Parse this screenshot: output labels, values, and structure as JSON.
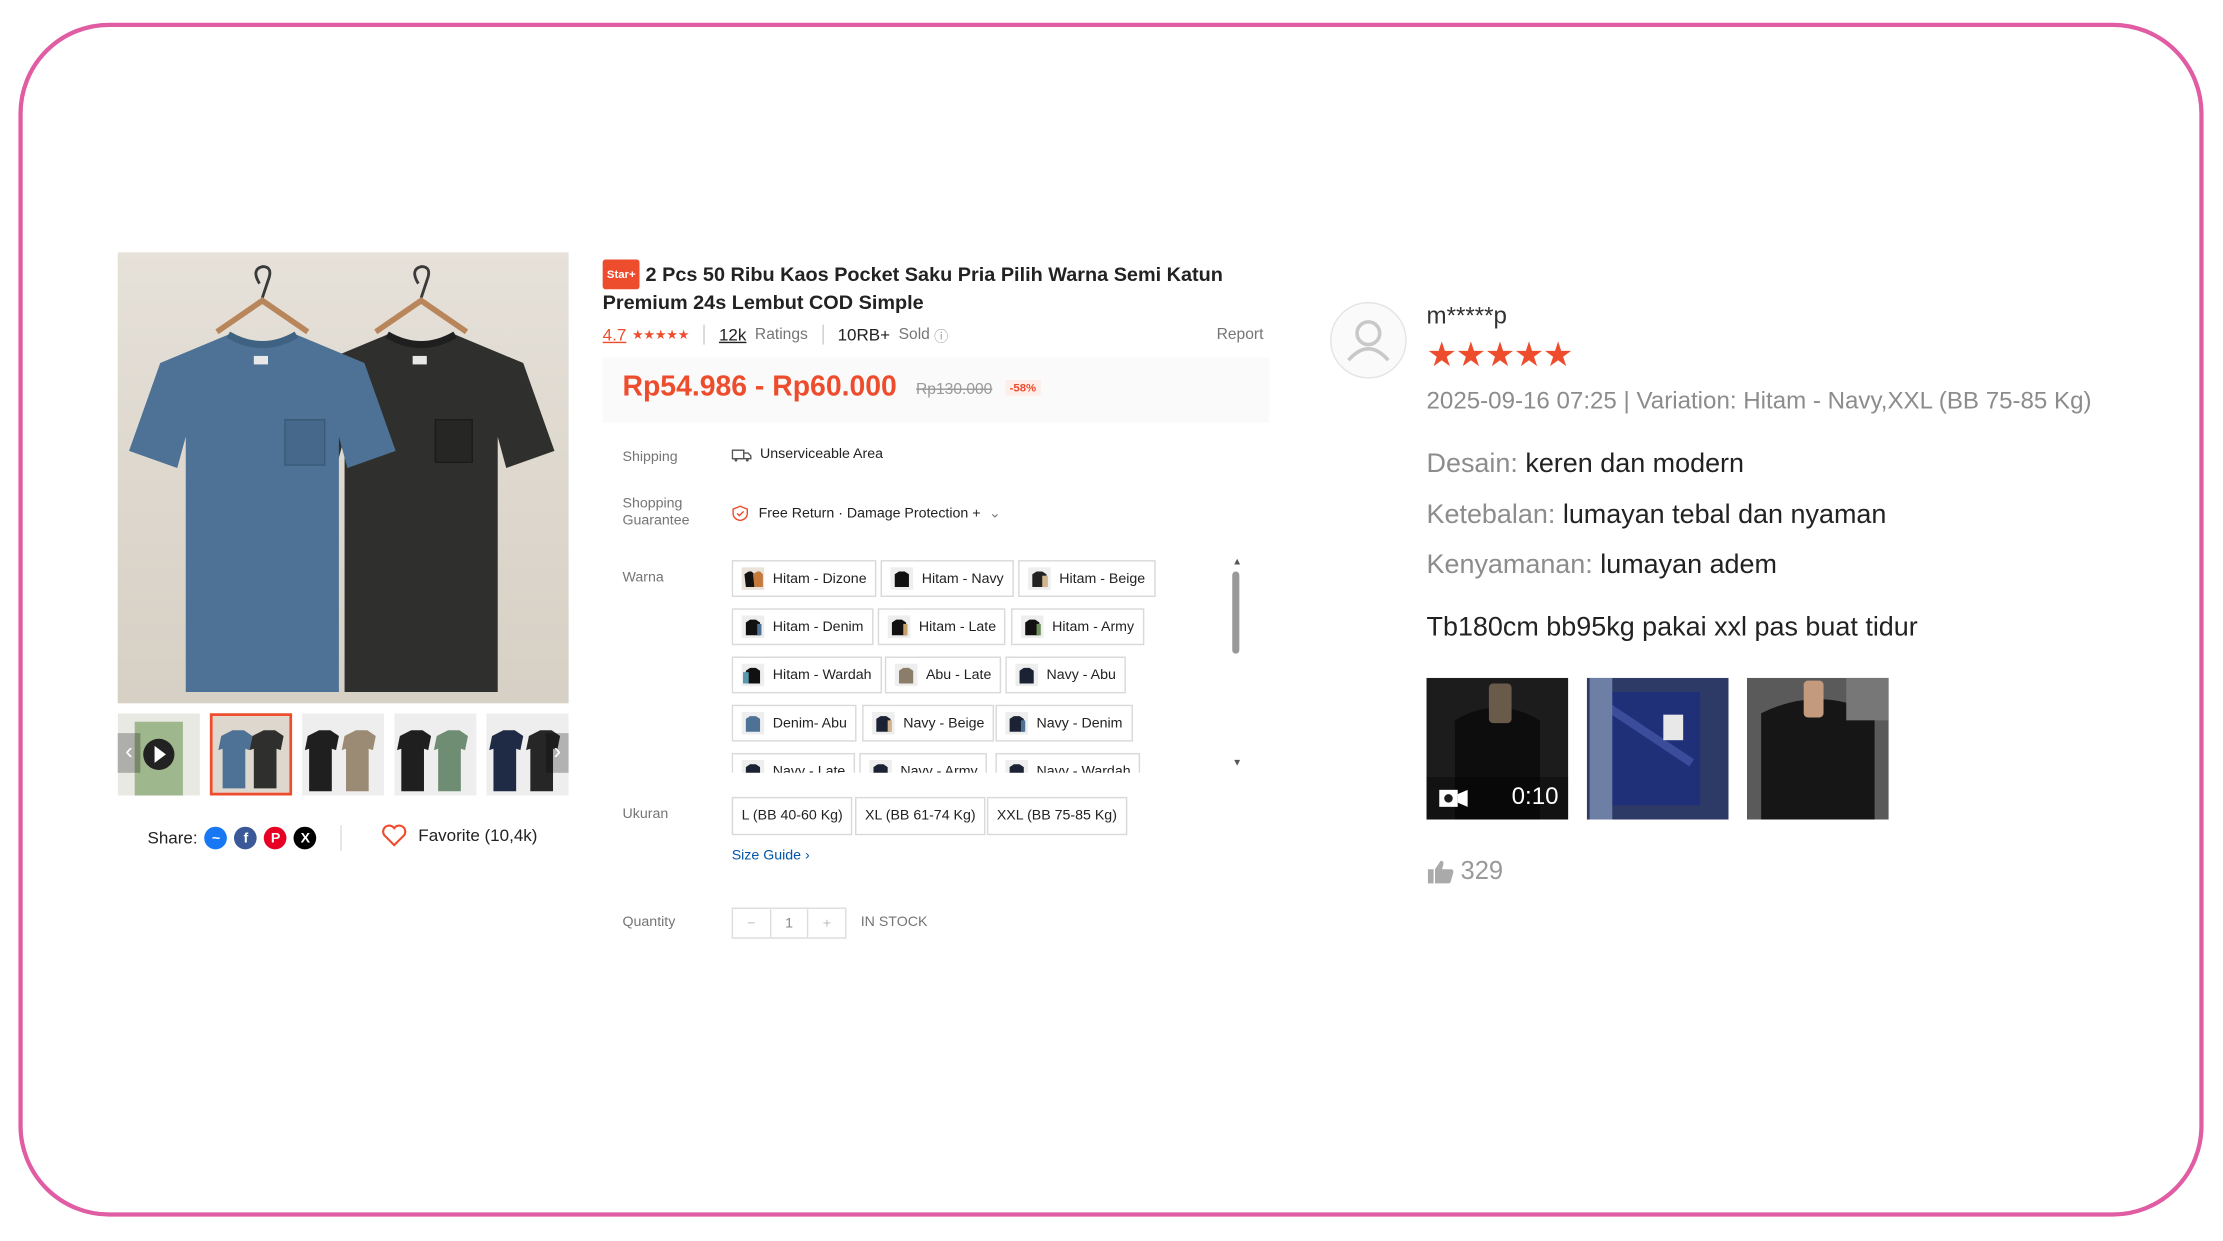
{
  "product": {
    "badge": "Star+",
    "title": "2 Pcs 50 Ribu Kaos Pocket Saku Pria Pilih Warna Semi Katun Premium 24s Lembut COD Simple",
    "rating": "4.7",
    "ratings_count": "12k",
    "ratings_label": "Ratings",
    "sold_count": "10RB+",
    "sold_label": "Sold",
    "report_label": "Report",
    "price": "Rp54.986 - Rp60.000",
    "old_price": "Rp130.000",
    "discount": "-58%",
    "shipping_label": "Shipping",
    "shipping_value": "Unserviceable Area",
    "guarantee_label": "Shopping Guarantee",
    "guarantee_value": "Free Return · Damage Protection +",
    "warna_label": "Warna",
    "variants": [
      "Hitam - Dizone",
      "Hitam - Navy",
      "Hitam - Beige",
      "Hitam - Denim",
      "Hitam - Late",
      "Hitam - Army",
      "Hitam - Wardah",
      "Abu - Late",
      "Navy - Abu",
      "Denim- Abu",
      "Navy - Beige",
      "Navy - Denim",
      "Navy - Late",
      "Navy - Army",
      "Navy - Wardah"
    ],
    "ukuran_label": "Ukuran",
    "sizes": [
      "L (BB 40-60 Kg)",
      "XL (BB 61-74 Kg)",
      "XXL (BB 75-85 Kg)"
    ],
    "size_guide": "Size Guide",
    "quantity_label": "Quantity",
    "quantity_value": "1",
    "stock": "IN STOCK",
    "share_label": "Share:",
    "favorite": "Favorite (10,4k)"
  },
  "review": {
    "reviewer": "m*****p",
    "stars": 5,
    "meta": "2025-09-16 07:25 | Variation: Hitam - Navy,XXL (BB 75-85 Kg)",
    "desain_label": "Desain:",
    "desain_value": "keren dan modern",
    "ketebalan_label": "Ketebalan:",
    "ketebalan_value": "lumayan tebal dan nyaman",
    "kenyamanan_label": "Kenyamanan:",
    "kenyamanan_value": "lumayan adem",
    "text": "Tb180cm bb95kg pakai xxl pas buat tidur",
    "video_duration": "0:10",
    "likes": "329"
  },
  "colors": {
    "accent": "#ee4d2d",
    "frame": "#e05ca3",
    "link": "#0055aa"
  }
}
